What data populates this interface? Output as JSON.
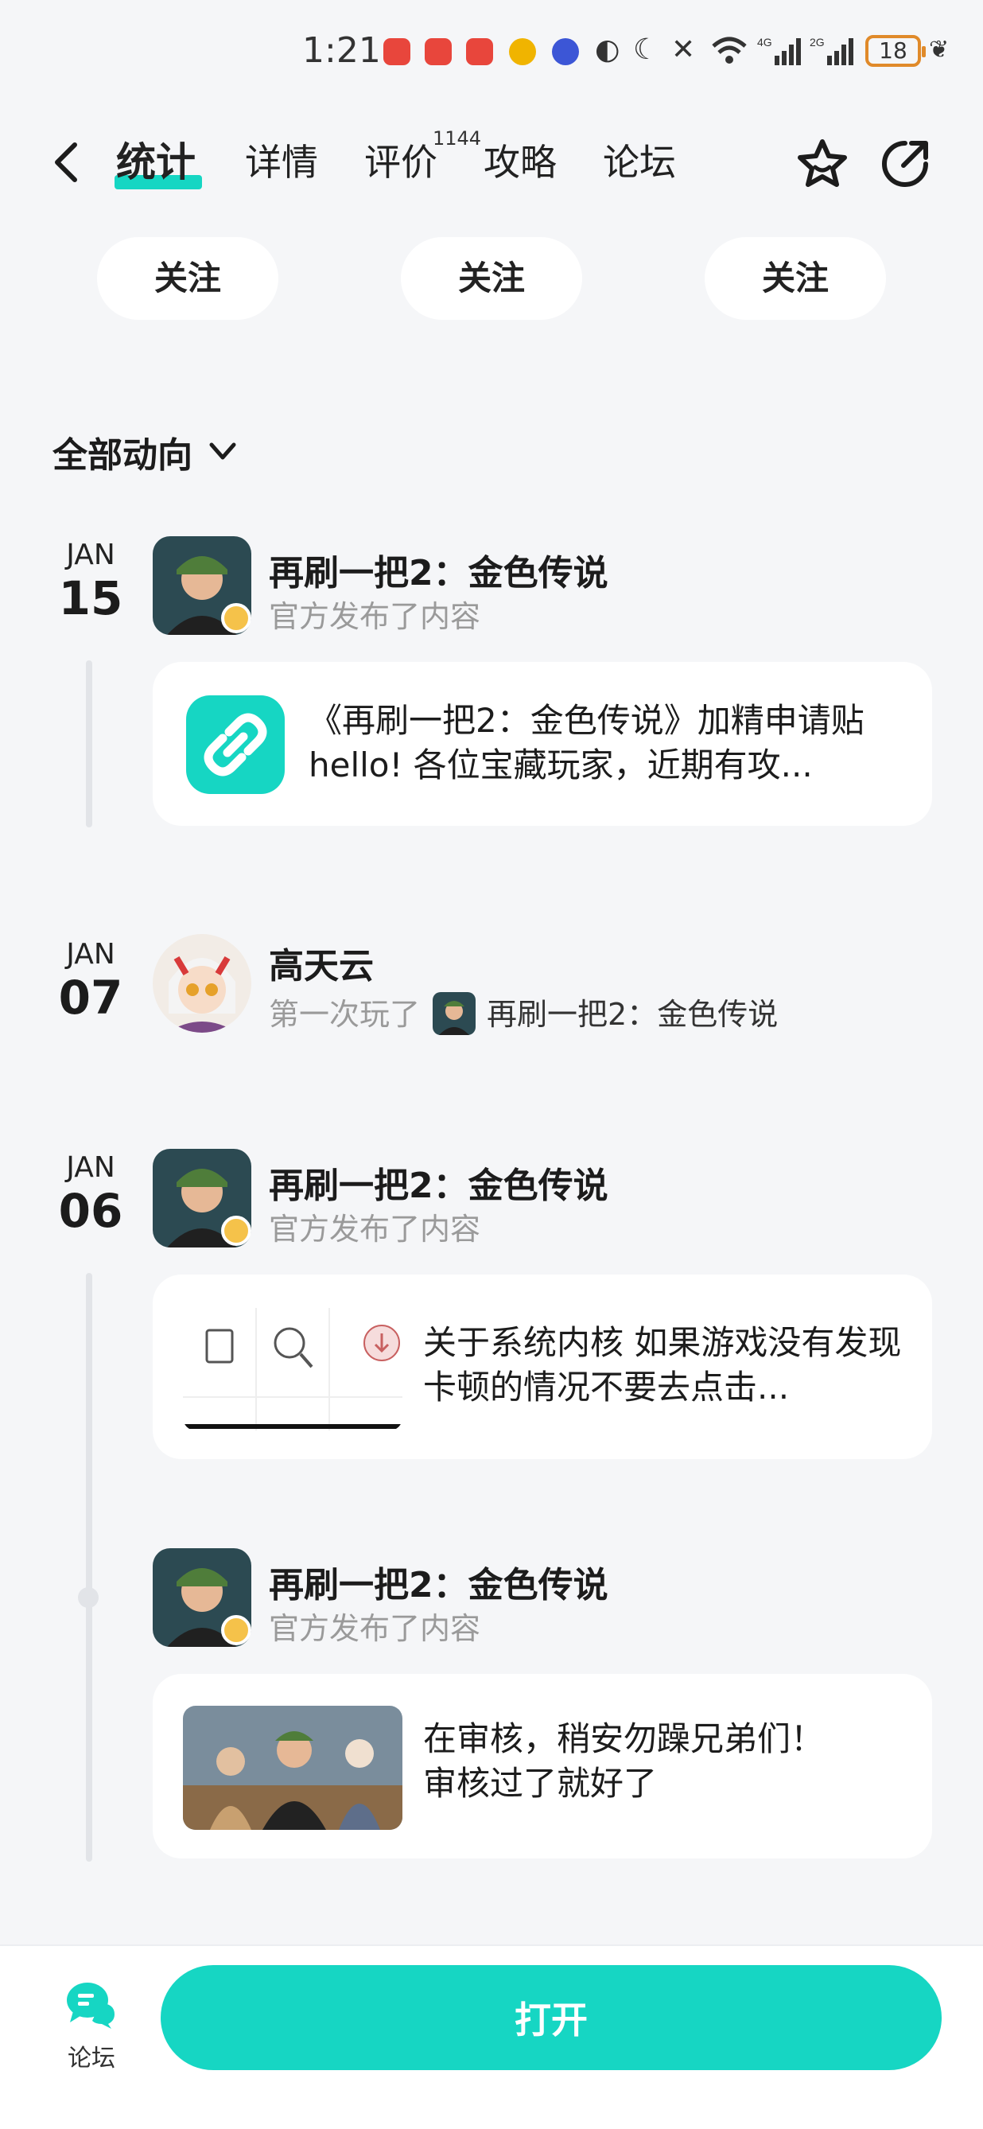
{
  "status": {
    "time": "1:21",
    "battery": "18"
  },
  "nav": {
    "tabs": [
      "统计",
      "详情",
      "评价",
      "攻略",
      "论坛"
    ],
    "review_count": "1144"
  },
  "follow_buttons": [
    "关注",
    "关注",
    "关注"
  ],
  "filter": {
    "label": "全部动向"
  },
  "feed": [
    {
      "month": "JAN",
      "day": "15",
      "author": "再刷一把2：金色传说",
      "action": "官方发布了内容",
      "card_text": "《再刷一把2：金色传说》加精申请贴 hello! 各位宝藏玩家，近期有攻..."
    },
    {
      "month": "JAN",
      "day": "07",
      "author": "高天云",
      "action": "第一次玩了",
      "game": "再刷一把2：金色传说"
    },
    {
      "month": "JAN",
      "day": "06",
      "author": "再刷一把2：金色传说",
      "action": "官方发布了内容",
      "card_text": "关于系统内核 如果游戏没有发现卡顿的情况不要去点击..."
    },
    {
      "author": "再刷一把2：金色传说",
      "action": "官方发布了内容",
      "card_text": "在审核，稍安勿躁兄弟们！\n审核过了就好了"
    }
  ],
  "bottom": {
    "forum_label": "论坛",
    "open_label": "打开"
  },
  "colors": {
    "accent": "#16d6c3",
    "background": "#f5f6f8"
  }
}
